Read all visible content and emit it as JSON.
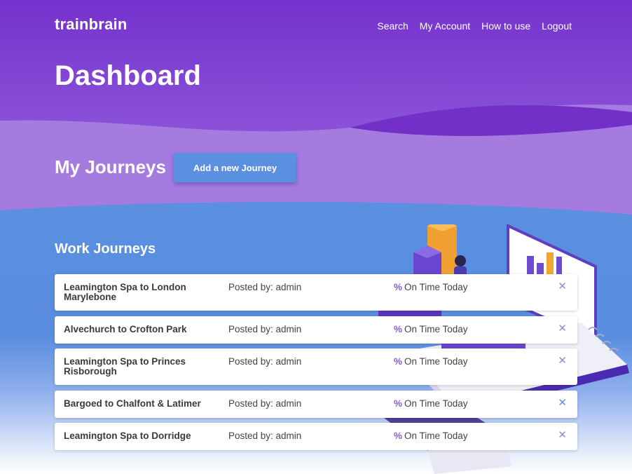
{
  "header": {
    "brand": "trainbrain",
    "nav": [
      {
        "label": "Search"
      },
      {
        "label": "My Account"
      },
      {
        "label": "How to use"
      },
      {
        "label": "Logout"
      }
    ],
    "page_title": "Dashboard"
  },
  "journeys": {
    "heading": "My Journeys",
    "add_button": "Add a new Journey",
    "section_title": "Work Journeys",
    "items": [
      {
        "route": "Leamington Spa to London Marylebone",
        "posted": "Posted by: admin",
        "pct_symbol": "%",
        "on_time": "On Time Today",
        "remove": "✕"
      },
      {
        "route": "Alvechurch to Crofton Park",
        "posted": "Posted by: admin",
        "pct_symbol": "%",
        "on_time": "On Time Today",
        "remove": "✕"
      },
      {
        "route": "Leamington Spa to Princes Risborough",
        "posted": "Posted by: admin",
        "pct_symbol": "%",
        "on_time": "On Time Today",
        "remove": "✕"
      },
      {
        "route": "Bargoed to Chalfont & Latimer",
        "posted": "Posted by: admin",
        "pct_symbol": "%",
        "on_time": "On Time Today",
        "remove": "✕"
      },
      {
        "route": "Leamington Spa to Dorridge",
        "posted": "Posted by: admin",
        "pct_symbol": "%",
        "on_time": "On Time Today",
        "remove": "✕"
      }
    ]
  },
  "icons": {
    "remove": "close-icon"
  },
  "colors": {
    "header_purple": "#7b3fd0",
    "lavender": "#a57be0",
    "blue": "#5b8fe0",
    "accent_percent": "#8a5fd0"
  }
}
